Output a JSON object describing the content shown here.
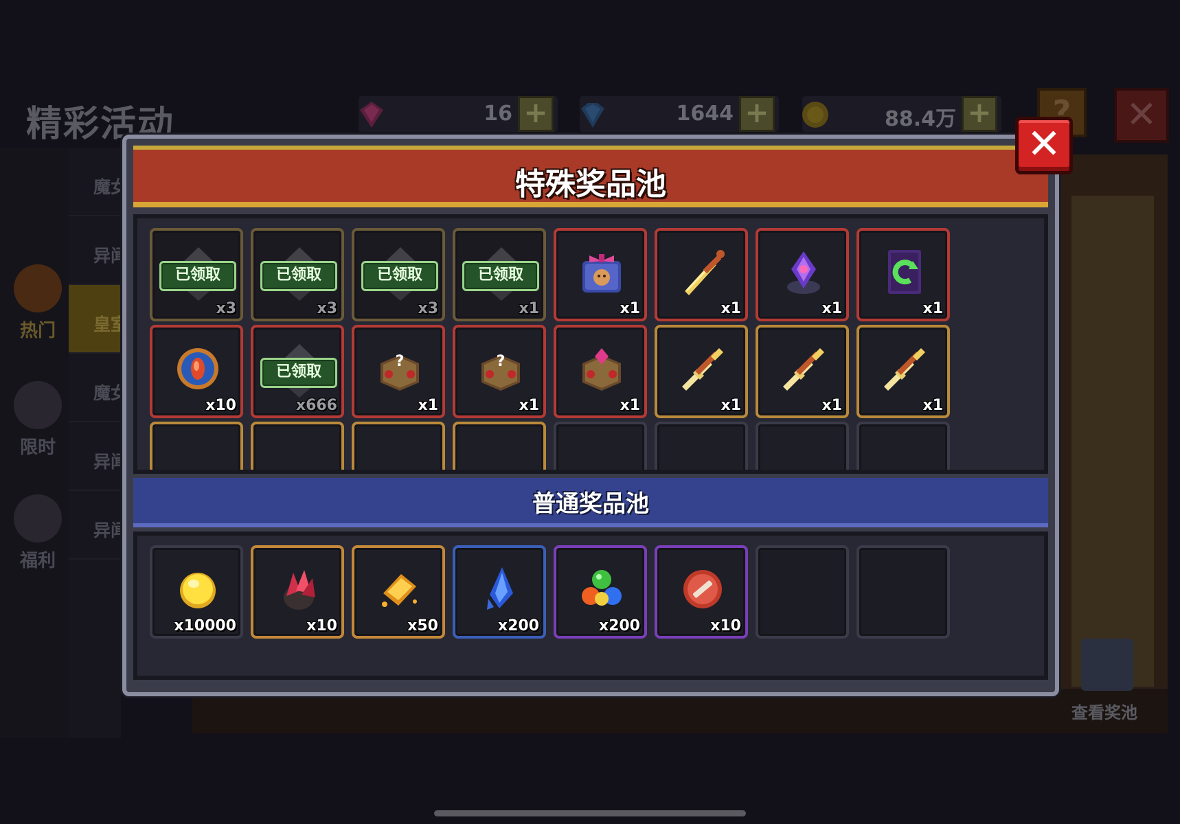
{
  "background": {
    "page_title": "精彩活动",
    "currencies": [
      {
        "icon": "pink-gem-icon",
        "value": "16",
        "color": "#c0307a"
      },
      {
        "icon": "blue-gem-icon",
        "value": "1644",
        "color": "#2f6fc0"
      },
      {
        "icon": "gold-coin-icon",
        "value": "88.4万",
        "color": "#c9a020"
      }
    ],
    "side_nav": [
      {
        "label": "热门",
        "icon": "flame-icon",
        "active": true
      },
      {
        "label": "限时",
        "icon": "clock-icon",
        "active": false
      },
      {
        "label": "福利",
        "icon": "gift-icon",
        "active": false
      }
    ],
    "sub_nav": [
      {
        "label": "魔女",
        "active": false
      },
      {
        "label": "异闻",
        "active": false
      },
      {
        "label": "皇室",
        "active": true
      },
      {
        "label": "魔女集",
        "active": false
      },
      {
        "label": "异闻",
        "active": false
      },
      {
        "label": "异闻",
        "active": false
      }
    ],
    "help_label": "?",
    "view_pool_label": "查看奖池"
  },
  "dialog": {
    "title": "特殊奖品池",
    "close_label": "✕",
    "normal_title": "普通奖品池",
    "claimed_label": "已领取",
    "special_items": [
      {
        "icon": "claimed-item-icon",
        "qty": "x3",
        "claimed": true,
        "frame": "brown"
      },
      {
        "icon": "claimed-item-icon",
        "qty": "x3",
        "claimed": true,
        "frame": "brown"
      },
      {
        "icon": "claimed-item-icon",
        "qty": "x3",
        "claimed": true,
        "frame": "brown"
      },
      {
        "icon": "claimed-item-icon",
        "qty": "x1",
        "claimed": true,
        "frame": "brown"
      },
      {
        "icon": "gift-box-icon",
        "qty": "x1",
        "claimed": false,
        "frame": "red"
      },
      {
        "icon": "golden-sword-icon",
        "qty": "x1",
        "claimed": false,
        "frame": "red"
      },
      {
        "icon": "purple-crystal-icon",
        "qty": "x1",
        "claimed": false,
        "frame": "red"
      },
      {
        "icon": "green-rune-card-icon",
        "qty": "x1",
        "claimed": false,
        "frame": "red"
      },
      {
        "icon": "blue-medal-icon",
        "qty": "x10",
        "claimed": false,
        "frame": "red"
      },
      {
        "icon": "claimed-item-icon",
        "qty": "x666",
        "claimed": true,
        "frame": "red"
      },
      {
        "icon": "mystery-chest-icon",
        "qty": "x1",
        "claimed": false,
        "frame": "red"
      },
      {
        "icon": "mystery-chest-icon",
        "qty": "x1",
        "claimed": false,
        "frame": "red"
      },
      {
        "icon": "gem-chest-icon",
        "qty": "x1",
        "claimed": false,
        "frame": "red"
      },
      {
        "icon": "cross-sword-icon",
        "qty": "x1",
        "claimed": false,
        "frame": "gold"
      },
      {
        "icon": "cross-sword-icon",
        "qty": "x1",
        "claimed": false,
        "frame": "gold"
      },
      {
        "icon": "cross-sword-icon",
        "qty": "x1",
        "claimed": false,
        "frame": "gold"
      }
    ],
    "normal_items": [
      {
        "icon": "gold-coin-icon",
        "qty": "x10000",
        "frame": "dark"
      },
      {
        "icon": "red-ore-icon",
        "qty": "x10",
        "frame": "orange"
      },
      {
        "icon": "gold-ingot-icon",
        "qty": "x50",
        "frame": "orange"
      },
      {
        "icon": "blue-shard-icon",
        "qty": "x200",
        "frame": "blue"
      },
      {
        "icon": "elemental-orbs-icon",
        "qty": "x200",
        "frame": "purple"
      },
      {
        "icon": "red-token-icon",
        "qty": "x10",
        "frame": "purple"
      },
      {
        "icon": "",
        "qty": "",
        "frame": "empty"
      },
      {
        "icon": "",
        "qty": "",
        "frame": "empty"
      }
    ]
  }
}
